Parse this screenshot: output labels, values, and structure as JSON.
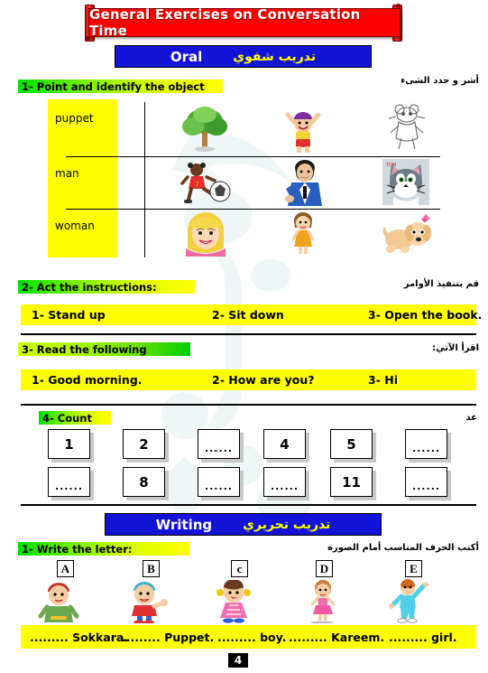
{
  "title_banner": {
    "text": "General Exercises on Conversation Time",
    "bg": "#FF0000",
    "fg": "#FFFFFF"
  },
  "sections": {
    "oral": {
      "en": "Oral",
      "ar": "تدريب شفوي",
      "bg": "#1313D8",
      "en_color": "#FFFFFF",
      "ar_color": "#FFFF00"
    },
    "writing": {
      "en": "Writing",
      "ar": "تدريب تحريري",
      "bg": "#1313D8",
      "en_color": "#FFFFFF",
      "ar_color": "#FFFF00"
    }
  },
  "ex1": {
    "label": "1- Point and identify the object",
    "ar_note": "أشر و حدد الشىء",
    "rows": [
      {
        "word": "puppet",
        "images": [
          "tree",
          "happy-boy-arms-up",
          "sketch-cartoon-mouse",
          ""
        ]
      },
      {
        "word": "man",
        "images": [
          "girl-playing-football",
          "man-in-blue-suit",
          "tom-cat",
          ""
        ]
      },
      {
        "word": "woman",
        "images": [
          "blonde-woman-face",
          "little-girl-orange-dress",
          "puppy-with-bow",
          ""
        ]
      }
    ]
  },
  "ex2": {
    "label": "2- Act the instructions:",
    "ar_note": "قم بتنفيذ الأوامر",
    "items": [
      "1- Stand up",
      "2- Sit down",
      "3- Open the book."
    ]
  },
  "ex3": {
    "label": "3- Read the following",
    "ar_note": "اقرأ الآتي:",
    "items": [
      "1- Good morning.",
      "2- How are you?",
      "3- Hi"
    ]
  },
  "ex4": {
    "label": "4- Count",
    "ar_note": "عد",
    "row1": [
      "1",
      "2",
      "......",
      "4",
      "5",
      "......"
    ],
    "row2": [
      "......",
      "8",
      "......",
      "......",
      "11",
      "......"
    ]
  },
  "ex5": {
    "label": "1- Write the letter:",
    "ar_note": "أكتب الحرف المناسب أمام الصورة",
    "letters": [
      "A",
      "B",
      "c",
      "D",
      "E"
    ],
    "pictures": [
      "boy-green-shirt",
      "boy-red-shirt-waving",
      "girl-pink-dress",
      "girl-pink-skirt",
      "boy-cyan-tracksuit"
    ],
    "answers": [
      "......... Sokkara.",
      "......... Puppet.",
      "......... boy.",
      "......... Kareem.",
      "......... girl."
    ]
  },
  "page_number": "4"
}
